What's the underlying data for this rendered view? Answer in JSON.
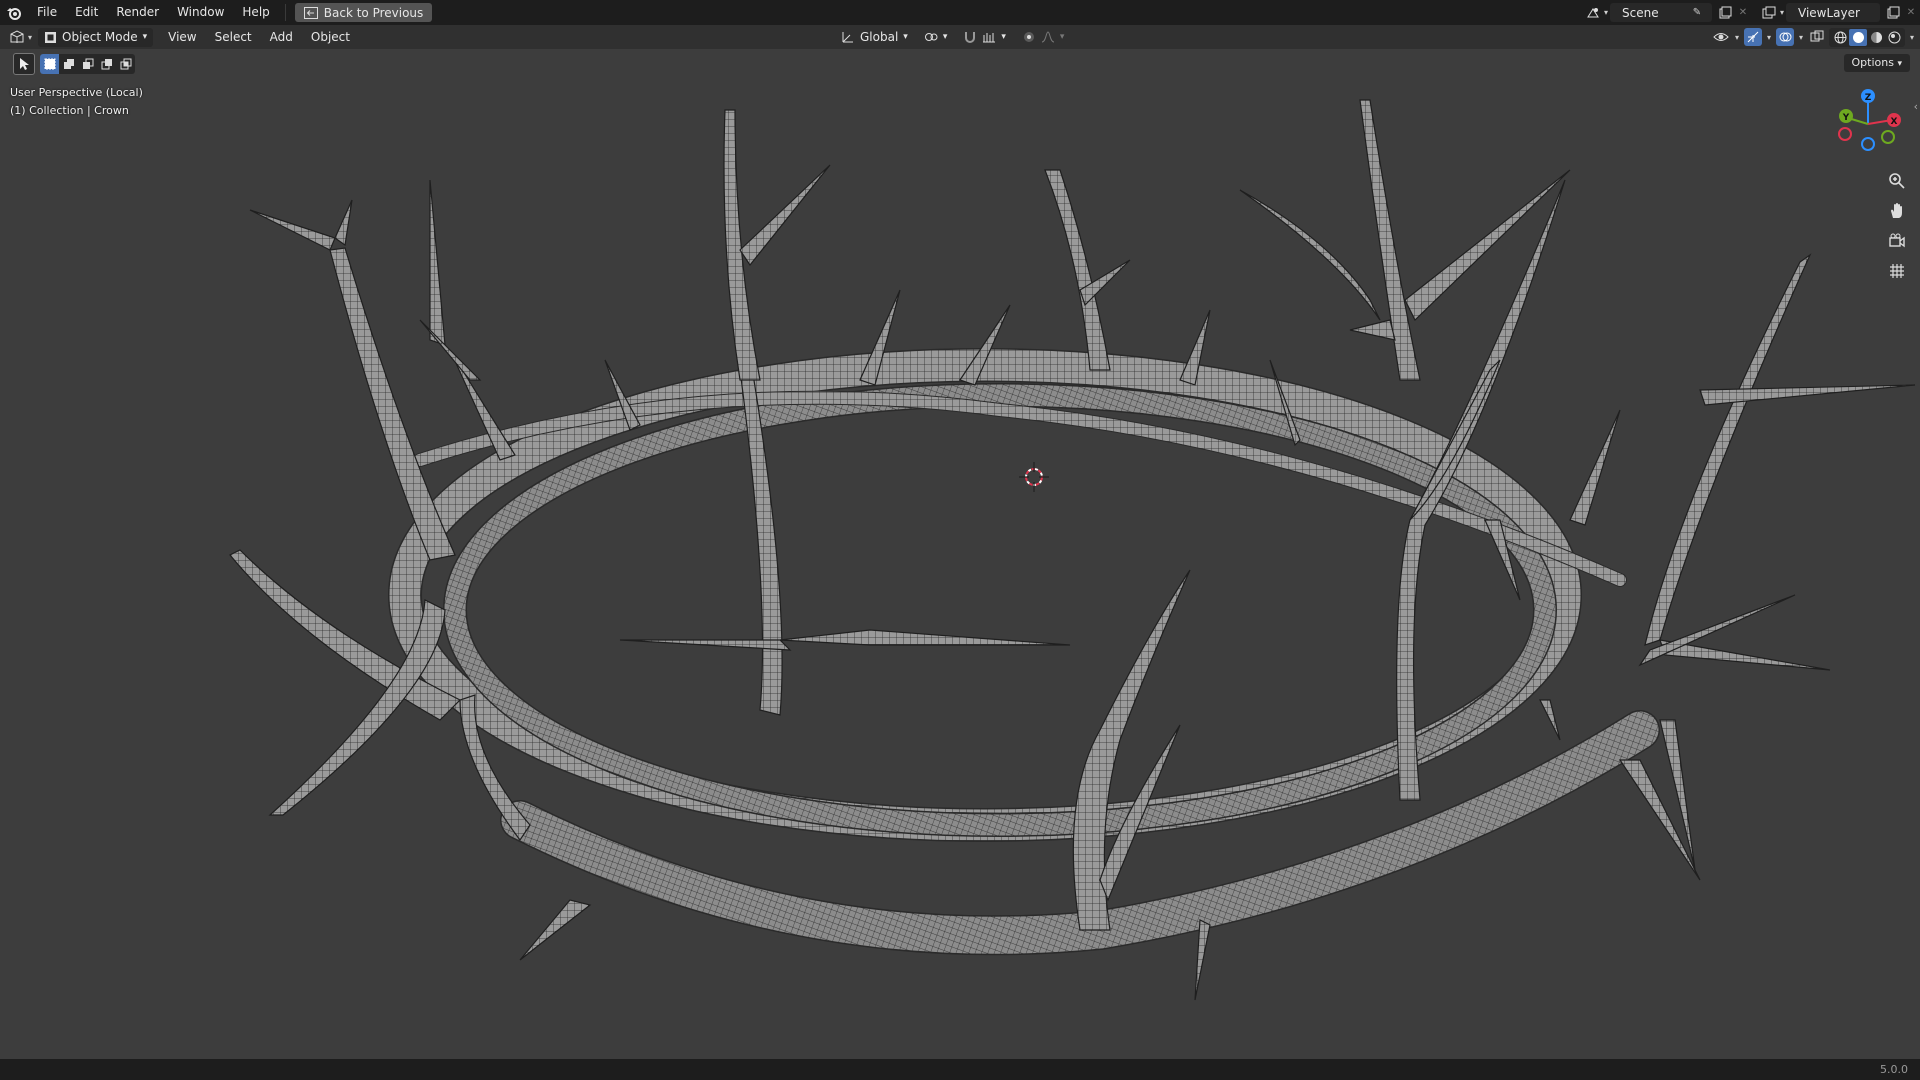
{
  "menu": {
    "items": [
      "File",
      "Edit",
      "Render",
      "Window",
      "Help"
    ],
    "back_label": "Back to Previous"
  },
  "topbar_right": {
    "scene": "Scene",
    "view_layer": "ViewLayer"
  },
  "viewport_header": {
    "mode": "Object Mode",
    "menus": [
      "View",
      "Select",
      "Add",
      "Object"
    ],
    "transform_orientation": "Global"
  },
  "options_label": "Options",
  "overlay": {
    "view_name": "User Perspective (Local)",
    "collection": "(1) Collection | Crown"
  },
  "gizmo": {
    "x_label": "X",
    "y_label": "Y",
    "z_label": "Z"
  },
  "status": {
    "version": "5.0.0"
  },
  "colors": {
    "accent": "#4772b3",
    "axis_x": "#e0344d",
    "axis_y": "#6ea920",
    "axis_z": "#2c8fff",
    "viewport_bg": "#3d3d3d"
  },
  "icons": {
    "app": "blender-logo-icon",
    "back": "back-arrow-icon",
    "scene": "scene-icon",
    "view_layer": "render-layers-icon",
    "zoom": "zoom-icon",
    "pan": "hand-icon",
    "camera": "camera-icon",
    "ortho": "grid-icon"
  }
}
